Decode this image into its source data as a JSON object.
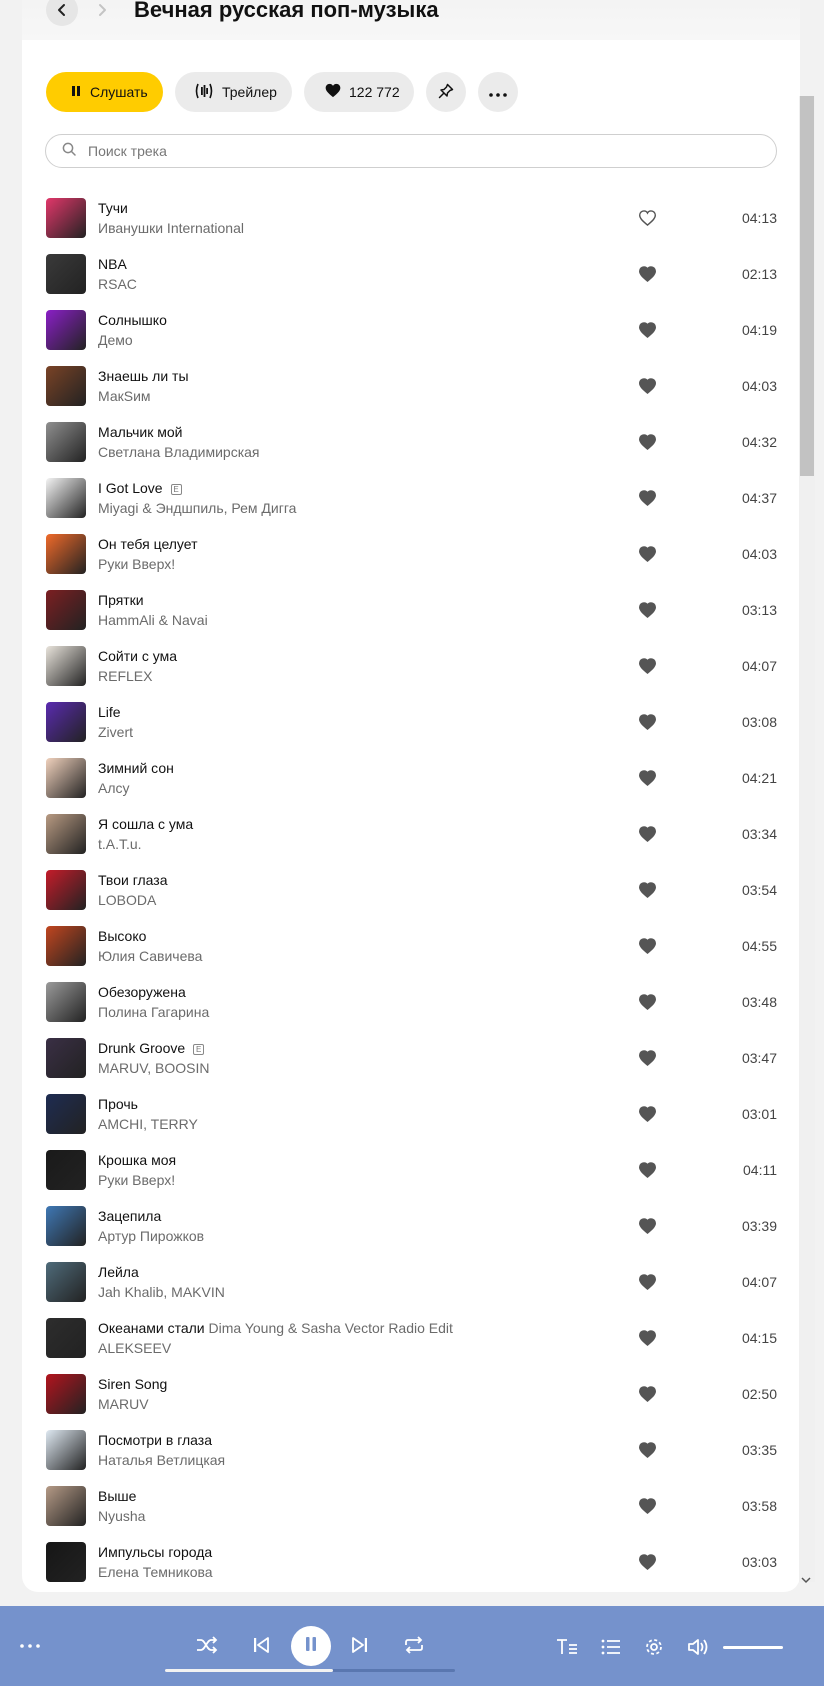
{
  "header": {
    "back_icon": "chevron-left-icon",
    "forward_icon": "chevron-right-icon",
    "title": "Вечная русская поп-музыка"
  },
  "actions": {
    "listen_label": "Слушать",
    "trailer_label": "Трейлер",
    "likes_count": "122 772",
    "pin_icon": "pin-icon",
    "more_icon": "more-dots-icon",
    "accent_color": "#ffcc00"
  },
  "search": {
    "placeholder": "Поиск трека"
  },
  "tracks": [
    {
      "title": "Тучи",
      "artist": "Иванушки International",
      "duration": "04:13",
      "liked": false,
      "explicit": false,
      "version": "",
      "cover": "#e2376a"
    },
    {
      "title": "NBA",
      "artist": "RSAC",
      "duration": "02:13",
      "liked": true,
      "explicit": false,
      "version": "",
      "cover": "#3a3a3a"
    },
    {
      "title": "Солнышко",
      "artist": "Демо",
      "duration": "04:19",
      "liked": true,
      "explicit": false,
      "version": "",
      "cover": "#8a1fc7"
    },
    {
      "title": "Знаешь ли ты",
      "artist": "МакSим",
      "duration": "04:03",
      "liked": true,
      "explicit": false,
      "version": "",
      "cover": "#7a4326"
    },
    {
      "title": "Мальчик мой",
      "artist": "Светлана Владимирская",
      "duration": "04:32",
      "liked": true,
      "explicit": false,
      "version": "",
      "cover": "#8f8f8f"
    },
    {
      "title": "I Got Love",
      "artist": "Miyagi & Эндшпиль, Рем Дигга",
      "duration": "04:37",
      "liked": true,
      "explicit": true,
      "version": "",
      "cover": "#f4f4f4"
    },
    {
      "title": "Он тебя целует",
      "artist": "Руки Вверх!",
      "duration": "04:03",
      "liked": true,
      "explicit": false,
      "version": "",
      "cover": "#f06a2a"
    },
    {
      "title": "Прятки",
      "artist": "HammAli & Navai",
      "duration": "03:13",
      "liked": true,
      "explicit": false,
      "version": "",
      "cover": "#7c1f22"
    },
    {
      "title": "Сойти с ума",
      "artist": "REFLEX",
      "duration": "04:07",
      "liked": true,
      "explicit": false,
      "version": "",
      "cover": "#e9e4dc"
    },
    {
      "title": "Life",
      "artist": "Zivert",
      "duration": "03:08",
      "liked": true,
      "explicit": false,
      "version": "",
      "cover": "#5a2bb0"
    },
    {
      "title": "Зимний сон",
      "artist": "Алсу",
      "duration": "04:21",
      "liked": true,
      "explicit": false,
      "version": "",
      "cover": "#f1d2bd"
    },
    {
      "title": "Я сошла с ума",
      "artist": "t.A.T.u.",
      "duration": "03:34",
      "liked": true,
      "explicit": false,
      "version": "",
      "cover": "#b89a82"
    },
    {
      "title": "Твои глаза",
      "artist": "LOBODA",
      "duration": "03:54",
      "liked": true,
      "explicit": false,
      "version": "",
      "cover": "#c41c2a"
    },
    {
      "title": "Высоко",
      "artist": "Юлия Савичева",
      "duration": "04:55",
      "liked": true,
      "explicit": false,
      "version": "",
      "cover": "#c2461f"
    },
    {
      "title": "Обезоружена",
      "artist": "Полина Гагарина",
      "duration": "03:48",
      "liked": true,
      "explicit": false,
      "version": "",
      "cover": "#9a9a9a"
    },
    {
      "title": "Drunk Groove",
      "artist": "MARUV, BOOSIN",
      "duration": "03:47",
      "liked": true,
      "explicit": true,
      "version": "",
      "cover": "#3a2f45"
    },
    {
      "title": "Прочь",
      "artist": "AMCHI, TERRY",
      "duration": "03:01",
      "liked": true,
      "explicit": false,
      "version": "",
      "cover": "#1e2c52"
    },
    {
      "title": "Крошка моя",
      "artist": "Руки Вверх!",
      "duration": "04:11",
      "liked": true,
      "explicit": false,
      "version": "",
      "cover": "#1a1a1a"
    },
    {
      "title": "Зацепила",
      "artist": "Артур Пирожков",
      "duration": "03:39",
      "liked": true,
      "explicit": false,
      "version": "",
      "cover": "#3f78b5"
    },
    {
      "title": "Лейла",
      "artist": "Jah Khalib, MAKVIN",
      "duration": "04:07",
      "liked": true,
      "explicit": false,
      "version": "",
      "cover": "#4f6b7a"
    },
    {
      "title": "Океанами стали",
      "artist": "ALEKSEEV",
      "duration": "04:15",
      "liked": true,
      "explicit": false,
      "version": "Dima Young & Sasha Vector Radio Edit",
      "cover": "#2d2d2d"
    },
    {
      "title": "Siren Song",
      "artist": "MARUV",
      "duration": "02:50",
      "liked": true,
      "explicit": false,
      "version": "",
      "cover": "#b3141e"
    },
    {
      "title": "Посмотри в глаза",
      "artist": "Наталья Ветлицкая",
      "duration": "03:35",
      "liked": true,
      "explicit": false,
      "version": "",
      "cover": "#dfe9f2"
    },
    {
      "title": "Выше",
      "artist": "Nyusha",
      "duration": "03:58",
      "liked": true,
      "explicit": false,
      "version": "",
      "cover": "#b59a86"
    },
    {
      "title": "Импульсы города",
      "artist": "Елена Темникова",
      "duration": "03:03",
      "liked": true,
      "explicit": false,
      "version": "",
      "cover": "#161616"
    }
  ],
  "player": {
    "bar_color": "#7592cc",
    "more_icon": "more-dots-icon",
    "shuffle_icon": "shuffle-icon",
    "prev_icon": "previous-icon",
    "pause_icon": "pause-icon",
    "next_icon": "next-icon",
    "repeat_icon": "repeat-icon",
    "lyrics_icon": "lyrics-icon",
    "queue_icon": "queue-icon",
    "settings_icon": "gear-icon",
    "volume_icon": "volume-icon",
    "progress": 0.58
  }
}
